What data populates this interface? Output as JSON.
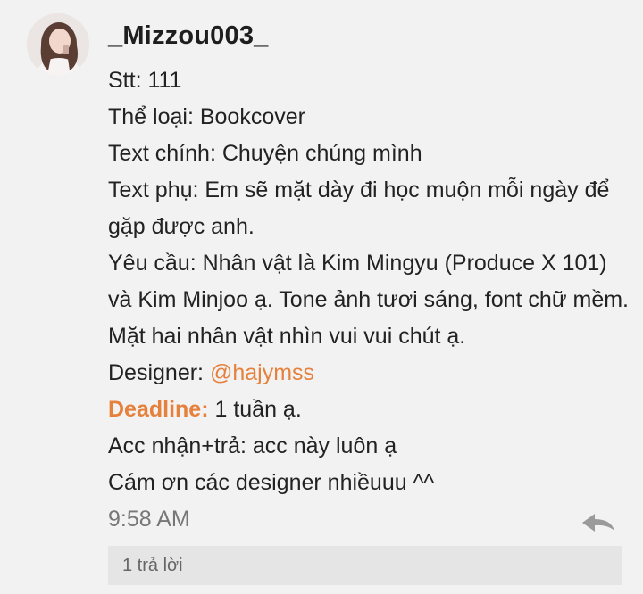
{
  "comment": {
    "username": "_Mizzou003_",
    "lines": {
      "stt": "Stt: 111",
      "the_loai": "Thể loại: Bookcover",
      "text_chinh": "Text chính: Chuyện chúng mình",
      "text_phu": "Text phụ: Em sẽ mặt dày đi học muộn mỗi ngày để gặp được anh.",
      "yeu_cau": "Yêu cầu: Nhân vật là Kim Mingyu (Produce X 101) và Kim Minjoo ạ. Tone ảnh tươi sáng, font chữ mềm. Mặt hai nhân vật nhìn vui vui chút ạ.",
      "designer_label": "Designer: ",
      "designer_mention": "@hajymss",
      "deadline_label": "Deadline:",
      "deadline_value": " 1 tuần ạ.",
      "acc": "Acc nhận+trả: acc này luôn ạ",
      "thanks": "Cám ơn các designer nhiềuuu ^^"
    },
    "timestamp": "9:58 AM",
    "reply_icon": "reply-arrow-icon",
    "replies_label": "1 trả lời"
  },
  "colors": {
    "accent": "#e5813c",
    "background": "#f2f2f2",
    "replies_bar": "#e5e5e5",
    "timestamp": "#777777"
  }
}
